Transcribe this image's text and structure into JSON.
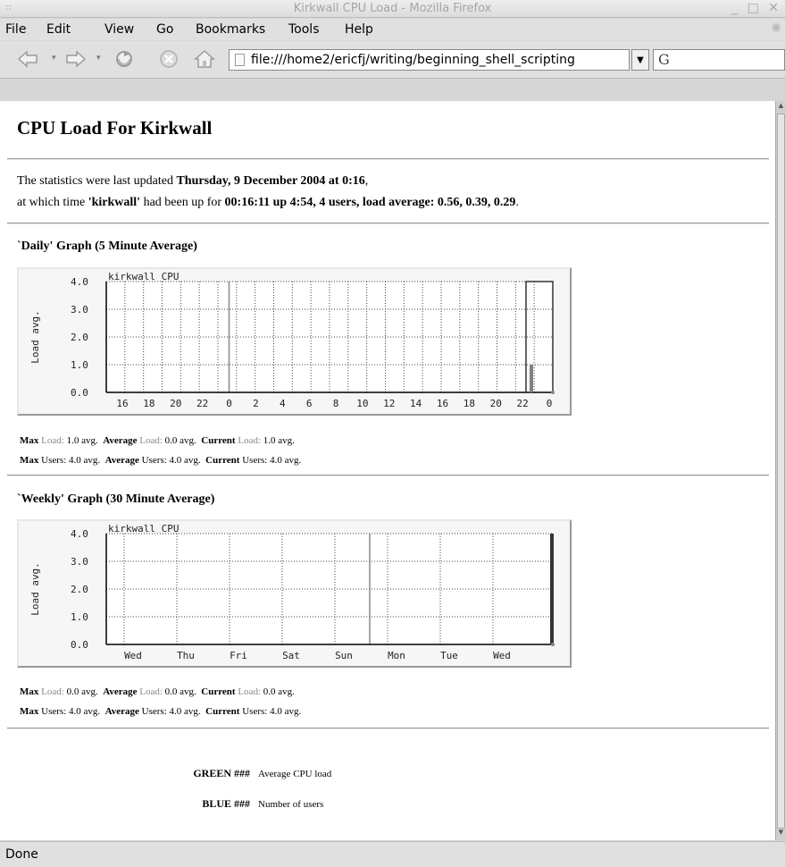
{
  "window": {
    "title": "Kirkwall CPU Load - Mozilla Firefox"
  },
  "menu": [
    "File",
    "Edit",
    "View",
    "Go",
    "Bookmarks",
    "Tools",
    "Help"
  ],
  "navbar": {
    "url": "file:///home2/ericfj/writing/beginning_shell_scripting"
  },
  "page": {
    "title": "CPU Load For Kirkwall",
    "updated_prefix": "The statistics were last updated ",
    "updated_date": "Thursday, 9 December 2004 at 0:16",
    "updated_suffix": ",",
    "uptime_prefix": "at which time ",
    "uptime_host": "'kirkwall'",
    "uptime_middle": " had been up for ",
    "uptime_value": "00:16:11 up 4:54, 4 users, load average: 0.56, 0.39, 0.29",
    "uptime_suffix": "."
  },
  "graphs": [
    {
      "heading": "`Daily' Graph (5 Minute Average)",
      "chart_label": "kirkwall CPU",
      "ylabel": "Load avg.",
      "yticks": [
        "0.0",
        "1.0",
        "2.0",
        "3.0",
        "4.0"
      ],
      "xticks": [
        "16",
        "18",
        "20",
        "22",
        "0",
        "2",
        "4",
        "6",
        "8",
        "10",
        "12",
        "14",
        "16",
        "18",
        "20",
        "22",
        "0"
      ],
      "stats": {
        "load": {
          "max": "Max",
          "max_label": "Load:",
          "max_val": "1.0 avg.",
          "avg": "Average",
          "avg_label": "Load:",
          "avg_val": "0.0 avg.",
          "cur": "Current",
          "cur_label": "Load:",
          "cur_val": "1.0 avg."
        },
        "users": {
          "max": "Max",
          "max_label": "Users:",
          "max_val": "4.0 avg.",
          "avg": "Average",
          "avg_label": "Users:",
          "avg_val": "4.0 avg.",
          "cur": "Current",
          "cur_label": "Users:",
          "cur_val": "4.0 avg."
        }
      }
    },
    {
      "heading": "`Weekly' Graph (30 Minute Average)",
      "chart_label": "kirkwall CPU",
      "ylabel": "Load avg.",
      "yticks": [
        "0.0",
        "1.0",
        "2.0",
        "3.0",
        "4.0"
      ],
      "xticks": [
        "Wed",
        "Thu",
        "Fri",
        "Sat",
        "Sun",
        "Mon",
        "Tue",
        "Wed"
      ],
      "stats": {
        "load": {
          "max": "Max",
          "max_label": "Load:",
          "max_val": "0.0 avg.",
          "avg": "Average",
          "avg_label": "Load:",
          "avg_val": "0.0 avg.",
          "cur": "Current",
          "cur_label": "Load:",
          "cur_val": "0.0 avg."
        },
        "users": {
          "max": "Max",
          "max_label": "Users:",
          "max_val": "4.0 avg.",
          "avg": "Average",
          "avg_label": "Users:",
          "avg_val": "4.0 avg.",
          "cur": "Current",
          "cur_label": "Users:",
          "cur_val": "4.0 avg."
        }
      }
    }
  ],
  "chart_data": [
    {
      "type": "bar",
      "title": "kirkwall CPU",
      "ylabel": "Load avg.",
      "ylim": [
        0,
        4
      ],
      "x_ticks": [
        "16",
        "18",
        "20",
        "22",
        "0",
        "2",
        "4",
        "6",
        "8",
        "10",
        "12",
        "14",
        "16",
        "18",
        "20",
        "22",
        "0"
      ],
      "series": [
        {
          "name": "Average CPU load",
          "color": "#808080",
          "points": [
            {
              "x": "22-0",
              "y": 1.0
            }
          ]
        },
        {
          "name": "Number of users",
          "color": "#333333",
          "points": [
            {
              "x": "22-0",
              "y": 4.0
            }
          ]
        }
      ],
      "grid": true
    },
    {
      "type": "bar",
      "title": "kirkwall CPU",
      "ylabel": "Load avg.",
      "ylim": [
        0,
        4
      ],
      "x_ticks": [
        "Wed",
        "Thu",
        "Fri",
        "Sat",
        "Sun",
        "Mon",
        "Tue",
        "Wed"
      ],
      "series": [
        {
          "name": "Number of users",
          "color": "#333333",
          "points": [
            {
              "x": "Wed",
              "y": 4.0
            }
          ]
        }
      ],
      "grid": true
    }
  ],
  "legend": [
    {
      "key": "GREEN ###",
      "desc": "Average CPU load"
    },
    {
      "key": "BLUE ###",
      "desc": "Number of users"
    }
  ],
  "status": "Done"
}
